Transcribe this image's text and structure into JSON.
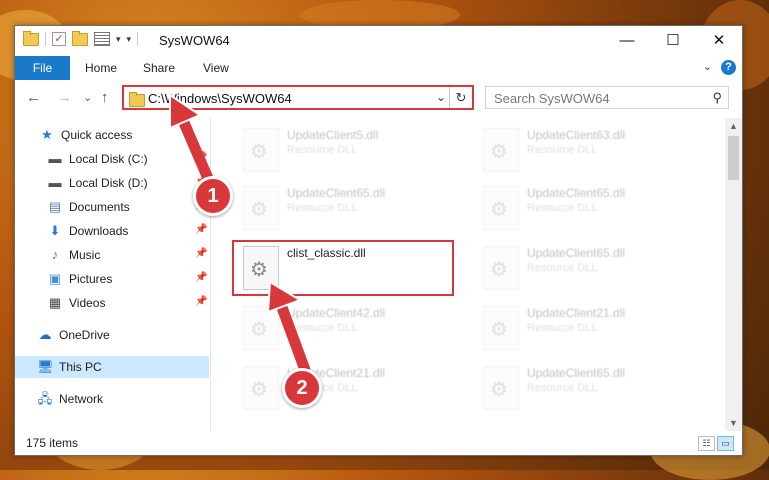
{
  "window": {
    "title": "SysWOW64",
    "minimize_glyph": "—",
    "maximize_glyph": "☐",
    "close_glyph": "✕"
  },
  "ribbon": {
    "file": "File",
    "home": "Home",
    "share": "Share",
    "view": "View",
    "help_glyph": "?"
  },
  "nav": {
    "back_glyph": "←",
    "forward_glyph": "→",
    "recent_glyph": "⌄",
    "up_glyph": "↑",
    "address": "C:\\Windows\\SysWOW64",
    "search_placeholder": "Search SysWOW64"
  },
  "sidebar": {
    "items": [
      {
        "label": "Quick access",
        "icon": "star-icon"
      },
      {
        "label": "Local Disk (C:)",
        "icon": "drive-icon"
      },
      {
        "label": "Local Disk (D:)",
        "icon": "drive-icon"
      },
      {
        "label": "Documents",
        "icon": "documents-icon"
      },
      {
        "label": "Downloads",
        "icon": "download-icon"
      },
      {
        "label": "Music",
        "icon": "music-icon"
      },
      {
        "label": "Pictures",
        "icon": "pictures-icon"
      },
      {
        "label": "Videos",
        "icon": "videos-icon"
      },
      {
        "label": "OneDrive",
        "icon": "cloud-icon"
      },
      {
        "label": "This PC",
        "icon": "computer-icon"
      },
      {
        "label": "Network",
        "icon": "network-icon"
      }
    ]
  },
  "files": [
    {
      "name": "UpdateClient5.dll",
      "type": "Resource DLL"
    },
    {
      "name": "UpdateClient63.dll",
      "type": "Resource DLL"
    },
    {
      "name": "UpdateClient65.dll",
      "type": "Resource DLL"
    },
    {
      "name": "UpdateClient65.dll",
      "type": "Resource DLL"
    },
    {
      "name": "clist_classic.dll",
      "type": ""
    },
    {
      "name": "UpdateClient65.dll",
      "type": "Resource DLL"
    },
    {
      "name": "UpdateClient42.dll",
      "type": "Resource DLL"
    },
    {
      "name": "UpdateClient21.dll",
      "type": "Resource DLL"
    },
    {
      "name": "UpdateClient21.dll",
      "type": "Resource DLL"
    },
    {
      "name": "UpdateClient65.dll",
      "type": "Resource DLL"
    }
  ],
  "status": {
    "item_count": "175 items"
  },
  "annotations": {
    "step1": "1",
    "step2": "2",
    "color": "#d9383b"
  }
}
